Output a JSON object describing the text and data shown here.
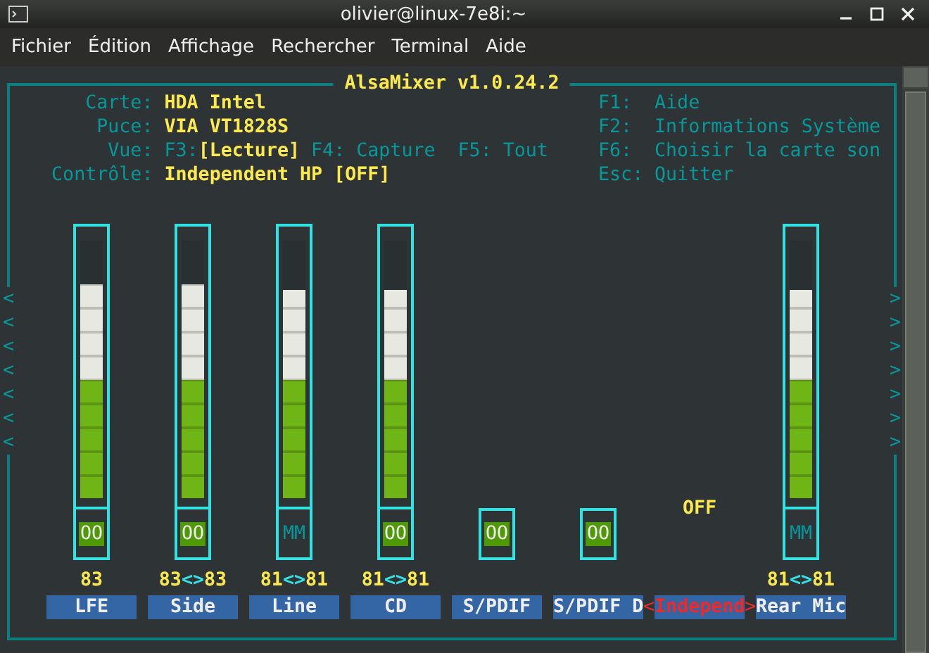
{
  "window": {
    "title": "olivier@linux-7e8i:~"
  },
  "menu": [
    "Fichier",
    "Édition",
    "Affichage",
    "Rechercher",
    "Terminal",
    "Aide"
  ],
  "mixer": {
    "title": "AlsaMixer v1.0.24.2",
    "info": [
      {
        "kind": "text",
        "label": "Carte:",
        "value": "HDA Intel"
      },
      {
        "kind": "text",
        "label": "Puce:",
        "value": "VIA VT1828S"
      },
      {
        "kind": "views",
        "label": "Vue:",
        "views": [
          {
            "key": "F3:",
            "label": "[Lecture]",
            "selected": true
          },
          {
            "key": "F4:",
            "label": "Capture",
            "selected": false
          },
          {
            "key": "F5:",
            "label": "Tout",
            "selected": false
          }
        ]
      },
      {
        "kind": "text",
        "label": "Contrôle:",
        "value": "Independent HP [OFF]"
      }
    ],
    "keys": [
      {
        "key": "F1:",
        "action": "Aide"
      },
      {
        "key": "F2:",
        "action": "Informations Système"
      },
      {
        "key": "F6:",
        "action": "Choisir la carte son"
      },
      {
        "key": "Esc:",
        "action": "Quitter"
      }
    ],
    "scroll_left": [
      "<",
      "<",
      "<",
      "<",
      "<",
      "<",
      "<"
    ],
    "scroll_right": [
      ">",
      ">",
      ">",
      ">",
      ">",
      ">",
      ">"
    ],
    "channels": [
      {
        "kind": "volume",
        "name": "LFE",
        "level": 0.83,
        "muted": false,
        "switch": "OO",
        "reading": [
          "83"
        ],
        "selected": false
      },
      {
        "kind": "volume",
        "name": "Side",
        "level": 0.83,
        "muted": false,
        "switch": "OO",
        "reading": [
          "83",
          "<>",
          "83"
        ],
        "selected": false
      },
      {
        "kind": "volume",
        "name": "Line",
        "level": 0.81,
        "muted": true,
        "switch": "MM",
        "reading": [
          "81",
          "<>",
          "81"
        ],
        "selected": false
      },
      {
        "kind": "volume",
        "name": "CD",
        "level": 0.81,
        "muted": false,
        "switch": "OO",
        "reading": [
          "81",
          "<>",
          "81"
        ],
        "selected": false
      },
      {
        "kind": "switch",
        "name": "S/PDIF",
        "muted": false,
        "switch": "OO",
        "selected": false
      },
      {
        "kind": "switch",
        "name": "S/PDIF D",
        "muted": false,
        "switch": "OO",
        "selected": false
      },
      {
        "kind": "enum",
        "name": "Independ",
        "value": "OFF",
        "selected": true,
        "markers": [
          "<",
          ">"
        ]
      },
      {
        "kind": "volume",
        "name": "Rear Mic",
        "level": 0.81,
        "muted": true,
        "switch": "MM",
        "reading": [
          "81",
          "<>",
          "81"
        ],
        "selected": false
      }
    ]
  }
}
